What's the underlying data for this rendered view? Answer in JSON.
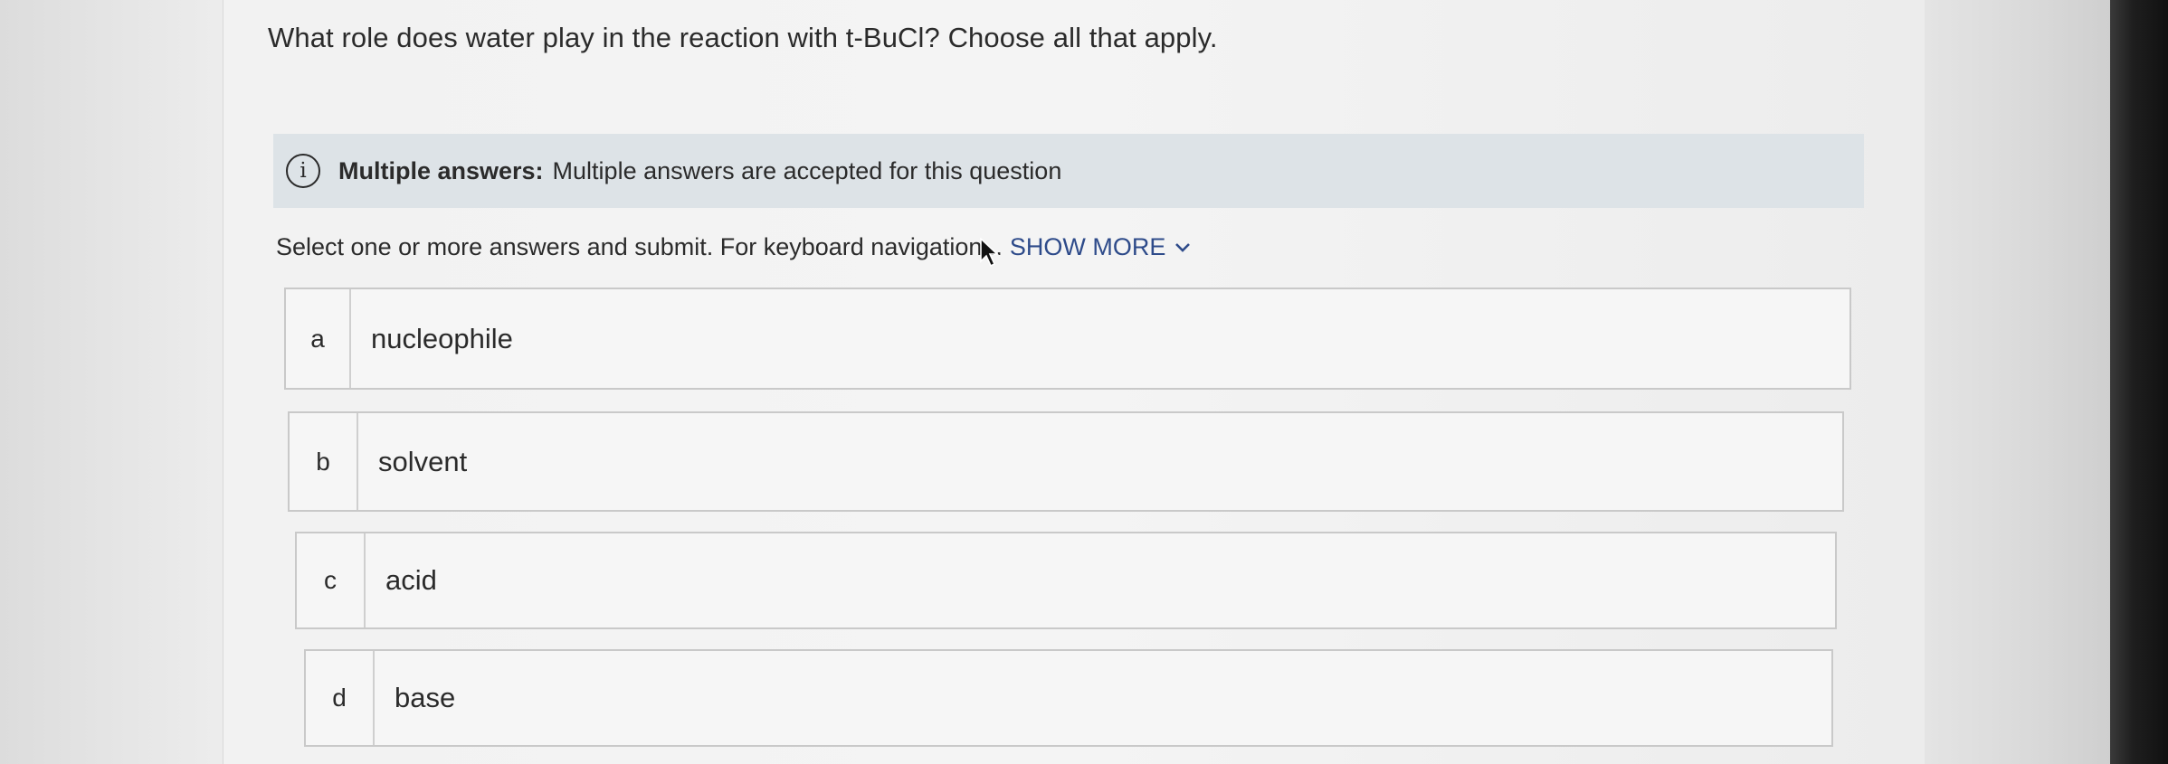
{
  "question": "What role does water play in the reaction with t-BuCl? Choose all that apply.",
  "info_banner": {
    "icon": "info-icon",
    "label": "Multiple answers:",
    "text": "Multiple answers are accepted for this question"
  },
  "instructions": {
    "text": "Select one or more answers and submit. For keyboard navigation...",
    "show_more": "SHOW MORE",
    "show_more_icon": "chevron-down-icon"
  },
  "options": [
    {
      "letter": "a",
      "text": "nucleophile"
    },
    {
      "letter": "b",
      "text": "solvent"
    },
    {
      "letter": "c",
      "text": "acid"
    },
    {
      "letter": "d",
      "text": "base"
    }
  ],
  "colors": {
    "link": "#2e4b8a",
    "banner_bg": "#dde3e7",
    "text": "#2b2b2b"
  }
}
